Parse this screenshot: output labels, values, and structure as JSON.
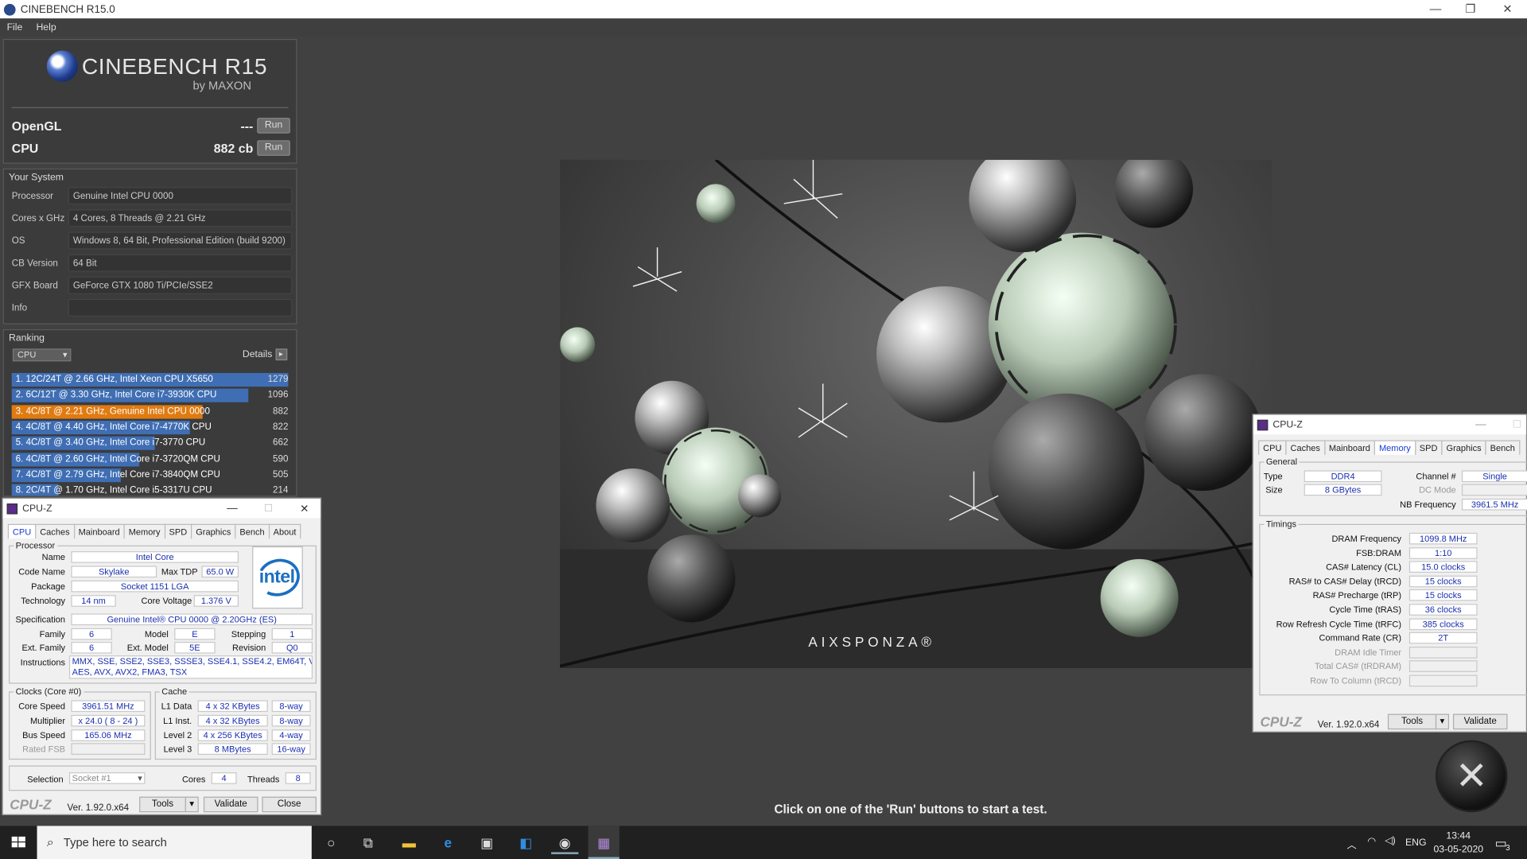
{
  "window": {
    "title": "CINEBENCH R15.0",
    "minimize": "—",
    "restore": "❐",
    "close": "✕"
  },
  "menu": [
    "File",
    "Help"
  ],
  "brand": {
    "name": "CINEBENCH R15",
    "by": "by MAXON"
  },
  "tests": [
    {
      "label": "OpenGL",
      "value": "---",
      "button": "Run"
    },
    {
      "label": "CPU",
      "value": "882 cb",
      "button": "Run"
    }
  ],
  "your_system": {
    "heading": "Your System",
    "rows": [
      {
        "key": "Processor",
        "value": "Genuine Intel CPU 0000"
      },
      {
        "key": "Cores x GHz",
        "value": "4 Cores, 8 Threads @ 2.21 GHz"
      },
      {
        "key": "OS",
        "value": "Windows 8, 64 Bit, Professional Edition (build 9200)"
      },
      {
        "key": "CB Version",
        "value": "64 Bit"
      },
      {
        "key": "GFX Board",
        "value": "GeForce GTX 1080 Ti/PCIe/SSE2"
      },
      {
        "key": "Info",
        "value": ""
      }
    ]
  },
  "ranking": {
    "heading": "Ranking",
    "dropdown": "CPU",
    "details": "Details",
    "max_score": 1279,
    "items": [
      {
        "label": "1. 12C/24T @ 2.66 GHz, Intel Xeon CPU X5650",
        "score": 1279,
        "color": "#3f6eb4"
      },
      {
        "label": "2. 6C/12T @ 3.30 GHz,  Intel Core i7-3930K CPU",
        "score": 1096,
        "color": "#3f6eb4"
      },
      {
        "label": "3. 4C/8T @ 2.21 GHz, Genuine Intel CPU 0000",
        "score": 882,
        "color": "#e07b12"
      },
      {
        "label": "4. 4C/8T @ 4.40 GHz, Intel Core i7-4770K CPU",
        "score": 822,
        "color": "#3f6eb4"
      },
      {
        "label": "5. 4C/8T @ 3.40 GHz,  Intel Core i7-3770 CPU",
        "score": 662,
        "color": "#3f6eb4"
      },
      {
        "label": "6. 4C/8T @ 2.60 GHz, Intel Core i7-3720QM CPU",
        "score": 590,
        "color": "#3f6eb4"
      },
      {
        "label": "7. 4C/8T @ 2.79 GHz,  Intel Core i7-3840QM CPU",
        "score": 505,
        "color": "#3f6eb4"
      },
      {
        "label": "8. 2C/4T @ 1.70 GHz,  Intel Core i5-3317U CPU",
        "score": 214,
        "color": "#3f6eb4"
      }
    ]
  },
  "render": {
    "watermark": "AIXSPONZA®"
  },
  "status_message": "Click on one of the 'Run' buttons to start a test.",
  "cpuz_cpu": {
    "title": "CPU-Z",
    "tabs": [
      "CPU",
      "Caches",
      "Mainboard",
      "Memory",
      "SPD",
      "Graphics",
      "Bench",
      "About"
    ],
    "processor_heading": "Processor",
    "name_label": "Name",
    "name": "Intel Core",
    "codename_label": "Code Name",
    "codename": "Skylake",
    "maxtdp_label": "Max TDP",
    "maxtdp": "65.0 W",
    "package_label": "Package",
    "package": "Socket 1151 LGA",
    "tech_label": "Technology",
    "tech": "14 nm",
    "corevolt_label": "Core Voltage",
    "corevolt": "1.376 V",
    "spec_label": "Specification",
    "spec": "Genuine Intel® CPU 0000 @ 2.20GHz (ES)",
    "family_label": "Family",
    "family": "6",
    "model_label": "Model",
    "model": "E",
    "stepping_label": "Stepping",
    "stepping": "1",
    "extfam_label": "Ext. Family",
    "extfam": "6",
    "extmodel_label": "Ext. Model",
    "extmodel": "5E",
    "revision_label": "Revision",
    "revision": "Q0",
    "instr_label": "Instructions",
    "instr1": "MMX, SSE, SSE2, SSE3, SSSE3, SSE4.1, SSE4.2, EM64T, VT-x,",
    "instr2": "AES, AVX, AVX2, FMA3, TSX",
    "clocks_heading": "Clocks (Core #0)",
    "corespeed_label": "Core Speed",
    "corespeed": "3961.51 MHz",
    "mult_label": "Multiplier",
    "mult": "x 24.0 ( 8 - 24 )",
    "bus_label": "Bus Speed",
    "bus": "165.06 MHz",
    "fsb_label": "Rated FSB",
    "cache_heading": "Cache",
    "l1d_label": "L1 Data",
    "l1d": "4 x 32 KBytes",
    "l1d_way": "8-way",
    "l1i_label": "L1 Inst.",
    "l1i": "4 x 32 KBytes",
    "l1i_way": "8-way",
    "l2_label": "Level 2",
    "l2": "4 x 256 KBytes",
    "l2_way": "4-way",
    "l3_label": "Level 3",
    "l3": "8 MBytes",
    "l3_way": "16-way",
    "selection_label": "Selection",
    "selection": "Socket #1",
    "cores_label": "Cores",
    "cores": "4",
    "threads_label": "Threads",
    "threads": "8",
    "logo": "CPU-Z",
    "version": "Ver. 1.92.0.x64",
    "tools": "Tools",
    "validate": "Validate",
    "close": "Close"
  },
  "cpuz_mem": {
    "title": "CPU-Z",
    "tabs": [
      "CPU",
      "Caches",
      "Mainboard",
      "Memory",
      "SPD",
      "Graphics",
      "Bench"
    ],
    "general_heading": "General",
    "type_label": "Type",
    "type": "DDR4",
    "channel_label": "Channel #",
    "channel": "Single",
    "size_label": "Size",
    "size": "8 GBytes",
    "dcmode_label": "DC Mode",
    "nbfreq_label": "NB Frequency",
    "nbfreq": "3961.5 MHz",
    "timings_heading": "Timings",
    "timings": [
      {
        "label": "DRAM Frequency",
        "value": "1099.8 MHz",
        "dim": false
      },
      {
        "label": "FSB:DRAM",
        "value": "1:10",
        "dim": false
      },
      {
        "label": "CAS# Latency (CL)",
        "value": "15.0 clocks",
        "dim": false
      },
      {
        "label": "RAS# to CAS# Delay (tRCD)",
        "value": "15 clocks",
        "dim": false
      },
      {
        "label": "RAS# Precharge (tRP)",
        "value": "15 clocks",
        "dim": false
      },
      {
        "label": "Cycle Time (tRAS)",
        "value": "36 clocks",
        "dim": false
      },
      {
        "label": "Row Refresh Cycle Time (tRFC)",
        "value": "385 clocks",
        "dim": false
      },
      {
        "label": "Command Rate (CR)",
        "value": "2T",
        "dim": false
      },
      {
        "label": "DRAM Idle Timer",
        "value": "",
        "dim": true
      },
      {
        "label": "Total CAS# (tRDRAM)",
        "value": "",
        "dim": true
      },
      {
        "label": "Row To Column (tRCD)",
        "value": "",
        "dim": true
      }
    ],
    "logo": "CPU-Z",
    "version": "Ver. 1.92.0.x64",
    "tools": "Tools",
    "validate": "Validate"
  },
  "taskbar": {
    "search_placeholder": "Type here to search",
    "lang": "ENG",
    "time": "13:44",
    "date": "03-05-2020",
    "notif_count": "3"
  }
}
